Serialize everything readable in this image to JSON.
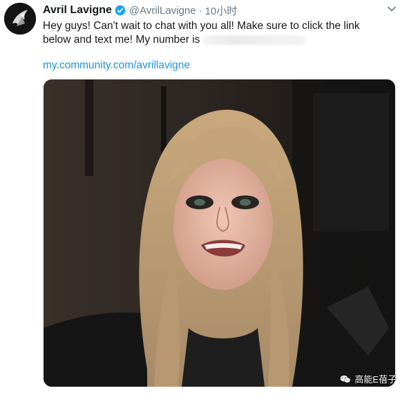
{
  "tweet": {
    "display_name": "Avril Lavigne",
    "handle": "@AvrilLavigne",
    "separator": "·",
    "time": "10小时",
    "text_line1": "Hey guys! Can't wait to chat with you all! Make sure to click the link",
    "text_line2": "below and text me! My number is",
    "link": "my.community.com/avrillavigne"
  },
  "icons": {
    "verified": "verified-badge-icon",
    "more": "chevron-down-icon",
    "watermark": "wechat-icon"
  },
  "watermark": {
    "text": "高能E蓓子"
  },
  "colors": {
    "link": "#1b95e0",
    "verified": "#1da1f2",
    "muted": "#657786"
  }
}
